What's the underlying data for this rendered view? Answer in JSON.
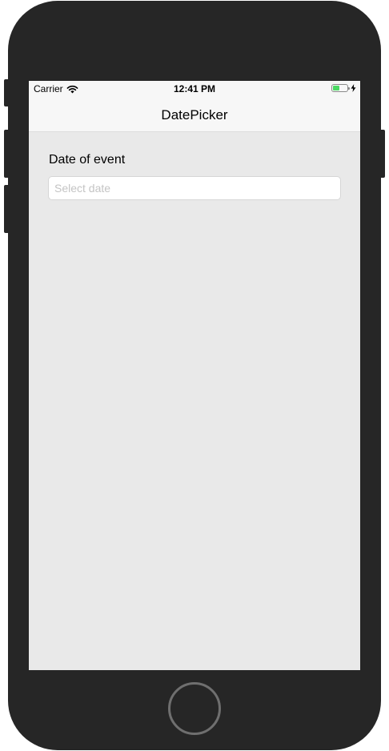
{
  "status_bar": {
    "carrier": "Carrier",
    "time": "12:41 PM",
    "battery_level": 0.45,
    "battery_color": "#4cd964",
    "icons": [
      "wifi-icon",
      "battery-icon",
      "charging-bolt-icon"
    ]
  },
  "nav": {
    "title": "DatePicker"
  },
  "form": {
    "date_label": "Date of event",
    "date_value": "",
    "date_placeholder": "Select date"
  },
  "colors": {
    "device_body": "#262626",
    "screen_background": "#e9e9e9",
    "bar_background": "#f7f7f7",
    "placeholder_text": "#c4c4c4"
  }
}
